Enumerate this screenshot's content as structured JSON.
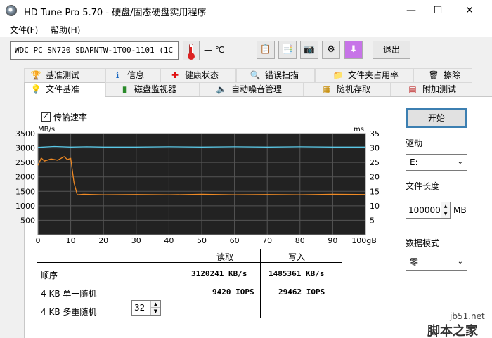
{
  "window": {
    "title": "HD Tune Pro 5.70 - 硬盘/固态硬盘实用程序",
    "minimize": "—",
    "maximize": "☐",
    "close": "✕"
  },
  "menu": [
    {
      "label": "文件(F)"
    },
    {
      "label": "帮助(H)"
    }
  ],
  "toolbar": {
    "drive": "WDC PC SN720 SDAPNTW-1T00-1101 (1C",
    "temperature": "— ℃",
    "icons": [
      "copy-text-icon",
      "copy-info-icon",
      "camera-icon",
      "options-icon",
      "download-icon"
    ],
    "exit_label": "退出"
  },
  "tabs_row1": [
    {
      "label": "基准测试",
      "icon": "trophy-icon"
    },
    {
      "label": "信息",
      "icon": "info-icon"
    },
    {
      "label": "健康状态",
      "icon": "health-icon"
    },
    {
      "label": "错误扫描",
      "icon": "magnifier-icon"
    },
    {
      "label": "文件夹占用率",
      "icon": "folder-icon"
    },
    {
      "label": "擦除",
      "icon": "trash-icon"
    }
  ],
  "tabs_row2": [
    {
      "label": "文件基准",
      "icon": "file-benchmark-icon",
      "active": true
    },
    {
      "label": "磁盘监视器",
      "icon": "disk-monitor-icon"
    },
    {
      "label": "自动噪音管理",
      "icon": "speaker-icon"
    },
    {
      "label": "随机存取",
      "icon": "random-access-icon"
    },
    {
      "label": "附加测试",
      "icon": "extra-tests-icon"
    }
  ],
  "benchmark": {
    "transfer_rate_checkbox": "传输速率",
    "transfer_rate_checked": true,
    "col_read": "读取",
    "col_write": "写入",
    "rows": [
      {
        "label": "顺序",
        "read": "3120241 KB/s",
        "write": "1485361 KB/s"
      },
      {
        "label": "4 KB 单一随机",
        "read": "9420 IOPS",
        "write": "29462 IOPS"
      },
      {
        "label": "4 KB 多重随机",
        "read": "",
        "write": ""
      }
    ],
    "queue_depth": "32"
  },
  "side_panel": {
    "start_label": "开始",
    "drive_label": "驱动",
    "drive_value": "E:",
    "file_length_label": "文件长度",
    "file_length_value": "100000",
    "file_length_unit": "MB",
    "data_mode_label": "数据模式",
    "data_mode_value": "零"
  },
  "chart_data": {
    "type": "line",
    "left_axis_unit": "MB/s",
    "right_axis_unit": "ms",
    "x_ticks": [
      "0",
      "10",
      "20",
      "30",
      "40",
      "50",
      "60",
      "70",
      "80",
      "90",
      "100gB"
    ],
    "y_ticks_left": [
      "3500",
      "3000",
      "2500",
      "2000",
      "1500",
      "1000",
      "500"
    ],
    "y_ticks_right": [
      "35",
      "30",
      "25",
      "20",
      "15",
      "10",
      "5"
    ],
    "xlim": [
      0,
      100
    ],
    "ylim_left": [
      0,
      3500
    ],
    "ylim_right": [
      0,
      35
    ],
    "grid": true,
    "background": "#222222",
    "series": [
      {
        "color": "#5bc8e6",
        "axis": "left",
        "x": [
          0,
          5,
          10,
          15,
          20,
          30,
          40,
          50,
          60,
          70,
          80,
          90,
          100
        ],
        "y": [
          3020,
          3050,
          3030,
          3040,
          3030,
          3030,
          3040,
          3030,
          3040,
          3030,
          3040,
          3030,
          3030
        ]
      },
      {
        "color": "#f08a24",
        "axis": "left",
        "x": [
          0,
          1,
          2,
          4,
          6,
          8,
          9,
          10,
          11,
          12,
          14,
          20,
          30,
          40,
          50,
          60,
          70,
          80,
          90,
          100
        ],
        "y": [
          2400,
          2650,
          2550,
          2620,
          2580,
          2700,
          2600,
          2640,
          1800,
          1380,
          1400,
          1380,
          1390,
          1380,
          1400,
          1380,
          1390,
          1380,
          1400,
          1390
        ]
      }
    ]
  },
  "watermark": {
    "site": "jb51.net",
    "name": "脚本之家"
  }
}
